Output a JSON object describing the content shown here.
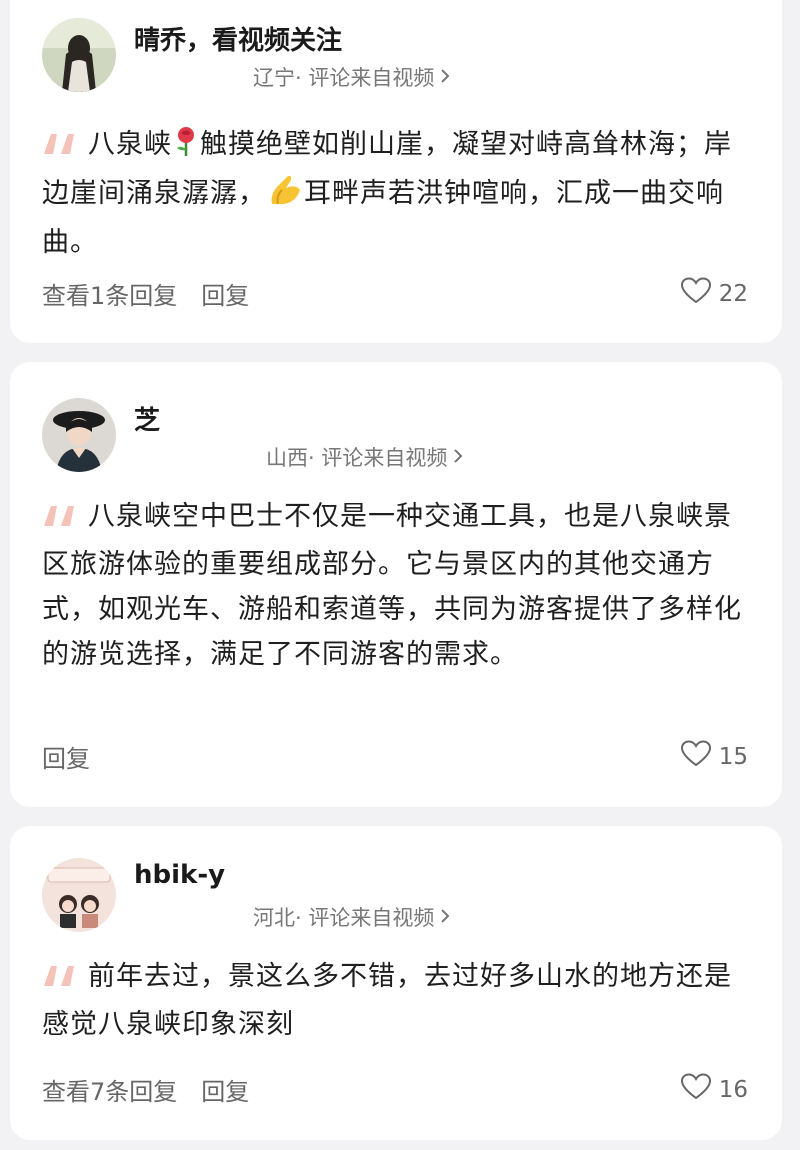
{
  "comments": [
    {
      "author": "晴乔，看视频关注",
      "location": "辽宁",
      "source_suffix": "· 评论来自视频",
      "text_parts": [
        "八泉峡",
        "触摸绝壁如削山崖，凝望对峙高耸林海；岸边崖间涌泉潺潺，",
        "耳畔声若洪钟喧响，汇成一曲交响曲。"
      ],
      "view_replies": "查看1条回复",
      "reply": "回复",
      "likes": "22"
    },
    {
      "author": "芝",
      "location": "山西",
      "source_suffix": "· 评论来自视频",
      "text": "八泉峡空中巴士不仅是一种交通工具，也是八泉峡景区旅游体验的重要组成部分。它与景区内的其他交通方式，如观光车、游船和索道等，共同为游客提供了多样化的游览选择，满足了不同游客的需求。",
      "reply": "回复",
      "likes": "15"
    },
    {
      "author": "hbik-y",
      "location": "河北",
      "source_suffix": "· 评论来自视频",
      "text": "前年去过，景这么多不错，去过好多山水的地方还是感觉八泉峡印象深刻",
      "view_replies": "查看7条回复",
      "reply": "回复",
      "likes": "16"
    }
  ],
  "colors": {
    "quote": "#f4c2b8",
    "text_secondary": "#777777",
    "background": "#f2f2f4"
  },
  "icons": [
    "quote-icon",
    "rose-icon",
    "folded-hands-icon",
    "heart-icon",
    "chevron-right-icon"
  ]
}
